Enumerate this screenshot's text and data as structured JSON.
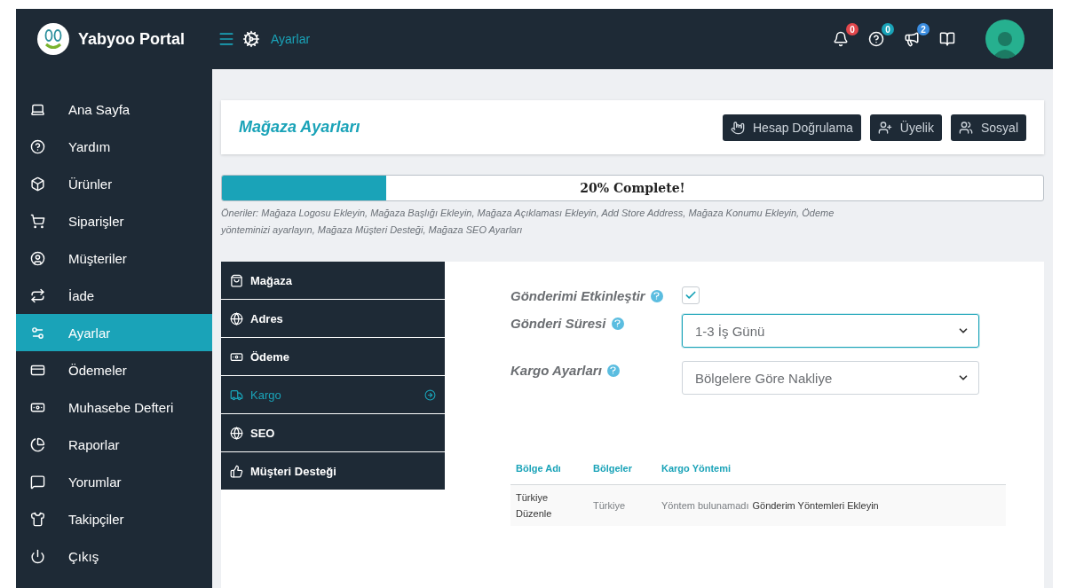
{
  "brand": {
    "title": "Yabyoo Portal"
  },
  "topbar": {
    "breadcrumb": "Ayarlar",
    "notifications": [
      {
        "count": "0",
        "color": "#e2474c"
      },
      {
        "count": "0",
        "color": "#1aa3b8"
      },
      {
        "count": "2",
        "color": "#3b8de0"
      }
    ]
  },
  "sidebar": {
    "items": [
      {
        "label": "Ana Sayfa",
        "selected": false
      },
      {
        "label": "Yardım",
        "selected": false
      },
      {
        "label": "Ürünler",
        "selected": false
      },
      {
        "label": "Siparişler",
        "selected": false
      },
      {
        "label": "Müşteriler",
        "selected": false
      },
      {
        "label": "İade",
        "selected": false
      },
      {
        "label": "Ayarlar",
        "selected": true
      },
      {
        "label": "Ödemeler",
        "selected": false
      },
      {
        "label": "Muhasebe Defteri",
        "selected": false
      },
      {
        "label": "Raporlar",
        "selected": false
      },
      {
        "label": "Yorumlar",
        "selected": false
      },
      {
        "label": "Takipçiler",
        "selected": false
      },
      {
        "label": "Çıkış",
        "selected": false
      }
    ]
  },
  "page_header": {
    "title": "Mağaza Ayarları",
    "buttons": [
      "Hesap Doğrulama",
      "Üyelik",
      "Sosyal"
    ]
  },
  "progress": {
    "level": 0.2,
    "label": "20% Complete!"
  },
  "suggestions": "Öneriler: Mağaza Logosu Ekleyin, Mağaza Başlığı Ekleyin, Mağaza Açıklaması Ekleyin, Add Store Address, Mağaza Konumu Ekleyin, Ödeme yönteminizi ayarlayın, Mağaza Müşteri Desteği, Mağaza SEO Ayarları",
  "tabs": [
    {
      "label": "Mağaza",
      "selected": false
    },
    {
      "label": "Adres",
      "selected": false
    },
    {
      "label": "Ödeme",
      "selected": false
    },
    {
      "label": "Kargo",
      "selected": true
    },
    {
      "label": "SEO",
      "selected": false
    },
    {
      "label": "Müşteri Desteği",
      "selected": false
    }
  ],
  "form": [
    {
      "kind": "checkbox",
      "label": "Gönderimi Etkinleştir",
      "checked": true
    },
    {
      "kind": "select",
      "label": "Gönderi Süresi",
      "value": "1-3 İş Günü",
      "focused": true
    },
    {
      "kind": "select",
      "label": "Kargo Ayarları",
      "value": "Bölgelere Göre Nakliye",
      "focused": false
    }
  ],
  "table": {
    "columns": [
      "Bölge Adı",
      "Bölgeler",
      "Kargo Yöntemi"
    ],
    "rows": [
      {
        "name": "Türkiye",
        "action": "Düzenle",
        "regions": "Türkiye",
        "method": "Yöntem bulunamadı",
        "method_link": "Gönderim Yöntemleri Ekleyin"
      }
    ]
  }
}
